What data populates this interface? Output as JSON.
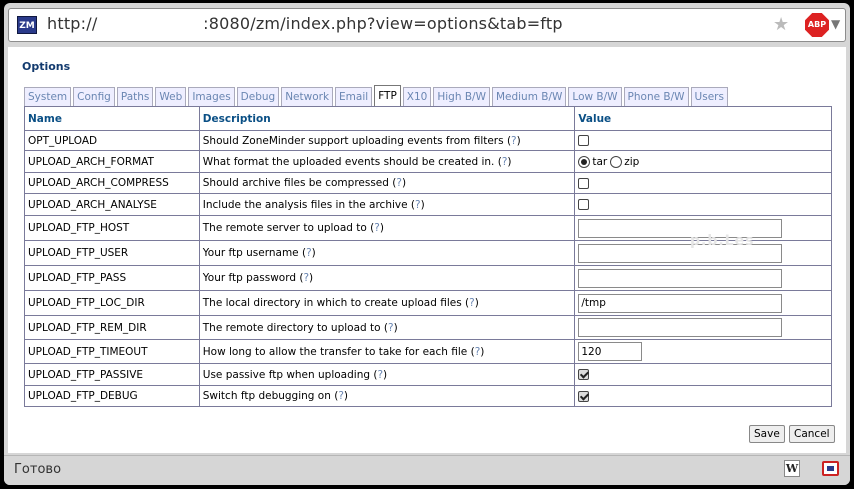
{
  "browser": {
    "url": "http://                    :8080/zm/index.php?view=options&tab=ftp",
    "zm_icon_label": "ZM",
    "abp_label": "ABP",
    "status": "Готово"
  },
  "page": {
    "title": "Options",
    "watermark": "p.b.Les"
  },
  "tabs": [
    {
      "label": "System",
      "active": false
    },
    {
      "label": "Config",
      "active": false
    },
    {
      "label": "Paths",
      "active": false
    },
    {
      "label": "Web",
      "active": false
    },
    {
      "label": "Images",
      "active": false
    },
    {
      "label": "Debug",
      "active": false
    },
    {
      "label": "Network",
      "active": false
    },
    {
      "label": "Email",
      "active": false
    },
    {
      "label": "FTP",
      "active": true
    },
    {
      "label": "X10",
      "active": false
    },
    {
      "label": "High B/W",
      "active": false
    },
    {
      "label": "Medium B/W",
      "active": false
    },
    {
      "label": "Low B/W",
      "active": false
    },
    {
      "label": "Phone B/W",
      "active": false
    },
    {
      "label": "Users",
      "active": false
    }
  ],
  "table": {
    "headers": {
      "name": "Name",
      "description": "Description",
      "value": "Value"
    },
    "help_text": "?",
    "rows": [
      {
        "name": "OPT_UPLOAD",
        "description": "Should ZoneMinder support uploading events from filters",
        "type": "checkbox",
        "checked": false
      },
      {
        "name": "UPLOAD_ARCH_FORMAT",
        "description": "What format the uploaded events should be created in.",
        "type": "radio",
        "options": [
          {
            "label": "tar",
            "selected": true
          },
          {
            "label": "zip",
            "selected": false
          }
        ]
      },
      {
        "name": "UPLOAD_ARCH_COMPRESS",
        "description": "Should archive files be compressed",
        "type": "checkbox",
        "checked": false
      },
      {
        "name": "UPLOAD_ARCH_ANALYSE",
        "description": "Include the analysis files in the archive",
        "type": "checkbox",
        "checked": false
      },
      {
        "name": "UPLOAD_FTP_HOST",
        "description": "The remote server to upload to",
        "type": "text",
        "value": "",
        "size": "wide"
      },
      {
        "name": "UPLOAD_FTP_USER",
        "description": "Your ftp username",
        "type": "text",
        "value": "",
        "size": "wide"
      },
      {
        "name": "UPLOAD_FTP_PASS",
        "description": "Your ftp password",
        "type": "text",
        "value": "",
        "size": "wide"
      },
      {
        "name": "UPLOAD_FTP_LOC_DIR",
        "description": "The local directory in which to create upload files",
        "type": "text",
        "value": "/tmp",
        "size": "wide"
      },
      {
        "name": "UPLOAD_FTP_REM_DIR",
        "description": "The remote directory to upload to",
        "type": "text",
        "value": "",
        "size": "wide"
      },
      {
        "name": "UPLOAD_FTP_TIMEOUT",
        "description": "How long to allow the transfer to take for each file",
        "type": "text",
        "value": "120",
        "size": "narrow"
      },
      {
        "name": "UPLOAD_FTP_PASSIVE",
        "description": "Use passive ftp when uploading",
        "type": "checkbox",
        "checked": true
      },
      {
        "name": "UPLOAD_FTP_DEBUG",
        "description": "Switch ftp debugging on",
        "type": "checkbox",
        "checked": true
      }
    ]
  },
  "buttons": {
    "save": "Save",
    "cancel": "Cancel"
  },
  "icons": {
    "star": "star-icon",
    "dropdown": "chevron-down-icon",
    "w": "W"
  }
}
